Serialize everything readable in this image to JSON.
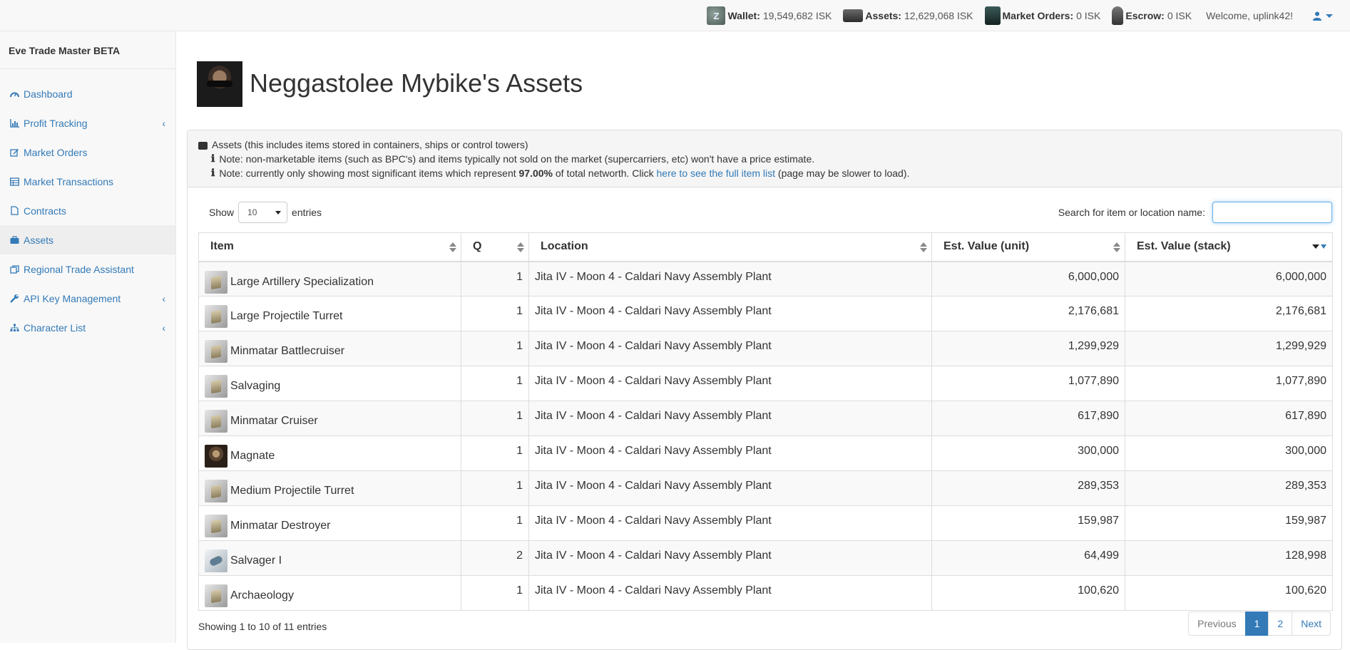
{
  "topbar": {
    "wallet_label": "Wallet:",
    "wallet_value": "19,549,682 ISK",
    "assets_label": "Assets:",
    "assets_value": "12,629,068 ISK",
    "orders_label": "Market Orders:",
    "orders_value": "0 ISK",
    "escrow_label": "Escrow:",
    "escrow_value": "0 ISK",
    "welcome": "Welcome, uplink42!"
  },
  "sidebar": {
    "brand": "Eve Trade Master BETA",
    "items": [
      {
        "label": "Dashboard",
        "icon": "dashboard-icon",
        "active": false,
        "has_submenu": false
      },
      {
        "label": "Profit Tracking",
        "icon": "bar-chart-icon",
        "active": false,
        "has_submenu": true
      },
      {
        "label": "Market Orders",
        "icon": "edit-icon",
        "active": false,
        "has_submenu": false
      },
      {
        "label": "Market Transactions",
        "icon": "table-icon",
        "active": false,
        "has_submenu": false
      },
      {
        "label": "Contracts",
        "icon": "file-icon",
        "active": false,
        "has_submenu": false
      },
      {
        "label": "Assets",
        "icon": "briefcase-icon",
        "active": true,
        "has_submenu": false
      },
      {
        "label": "Regional Trade Assistant",
        "icon": "clone-icon",
        "active": false,
        "has_submenu": false
      },
      {
        "label": "API Key Management",
        "icon": "wrench-icon",
        "active": false,
        "has_submenu": true
      },
      {
        "label": "Character List",
        "icon": "sitemap-icon",
        "active": false,
        "has_submenu": true
      }
    ]
  },
  "page": {
    "title": "Neggastolee Mybike's Assets"
  },
  "panel": {
    "heading": "Assets (this includes items stored in containers, ships or control towers)",
    "note1": "Note: non-marketable items (such as BPC's) and items typically not sold on the market (supercarriers, etc) won't have a price estimate.",
    "note2_pre": "Note: currently only showing most significant items which represent ",
    "note2_bold": "97.00%",
    "note2_mid": " of total networth. Click ",
    "note2_link": "here to see the full item list",
    "note2_post": " (page may be slower to load)."
  },
  "controls": {
    "show_label": "Show",
    "page_length": "10",
    "entries_label": "entries",
    "search_label": "Search for item or location name:",
    "search_value": ""
  },
  "table": {
    "headers": [
      "Item",
      "Q",
      "Location",
      "Est. Value (unit)",
      "Est. Value (stack)"
    ],
    "rows": [
      {
        "item": "Large Artillery Specialization",
        "icon": "skillbook-icon",
        "q": "1",
        "location": "Jita IV - Moon 4 - Caldari Navy Assembly Plant",
        "unit": "6,000,000",
        "stack": "6,000,000"
      },
      {
        "item": "Large Projectile Turret",
        "icon": "skillbook-icon",
        "q": "1",
        "location": "Jita IV - Moon 4 - Caldari Navy Assembly Plant",
        "unit": "2,176,681",
        "stack": "2,176,681"
      },
      {
        "item": "Minmatar Battlecruiser",
        "icon": "skillbook-icon",
        "q": "1",
        "location": "Jita IV - Moon 4 - Caldari Navy Assembly Plant",
        "unit": "1,299,929",
        "stack": "1,299,929"
      },
      {
        "item": "Salvaging",
        "icon": "skillbook-icon",
        "q": "1",
        "location": "Jita IV - Moon 4 - Caldari Navy Assembly Plant",
        "unit": "1,077,890",
        "stack": "1,077,890"
      },
      {
        "item": "Minmatar Cruiser",
        "icon": "skillbook-icon",
        "q": "1",
        "location": "Jita IV - Moon 4 - Caldari Navy Assembly Plant",
        "unit": "617,890",
        "stack": "617,890"
      },
      {
        "item": "Magnate",
        "icon": "ship-portrait-icon",
        "q": "1",
        "location": "Jita IV - Moon 4 - Caldari Navy Assembly Plant",
        "unit": "300,000",
        "stack": "300,000"
      },
      {
        "item": "Medium Projectile Turret",
        "icon": "skillbook-icon",
        "q": "1",
        "location": "Jita IV - Moon 4 - Caldari Navy Assembly Plant",
        "unit": "289,353",
        "stack": "289,353"
      },
      {
        "item": "Minmatar Destroyer",
        "icon": "skillbook-icon",
        "q": "1",
        "location": "Jita IV - Moon 4 - Caldari Navy Assembly Plant",
        "unit": "159,987",
        "stack": "159,987"
      },
      {
        "item": "Salvager I",
        "icon": "salvager-icon",
        "q": "2",
        "location": "Jita IV - Moon 4 - Caldari Navy Assembly Plant",
        "unit": "64,499",
        "stack": "128,998"
      },
      {
        "item": "Archaeology",
        "icon": "skillbook-icon",
        "q": "1",
        "location": "Jita IV - Moon 4 - Caldari Navy Assembly Plant",
        "unit": "100,620",
        "stack": "100,620"
      }
    ]
  },
  "footer": {
    "info": "Showing 1 to 10 of 11 entries",
    "prev": "Previous",
    "pages": [
      "1",
      "2"
    ],
    "next": "Next"
  },
  "colors": {
    "link": "#337ab7",
    "active_page": "#337ab7",
    "sidebar_bg": "#f8f8f8"
  }
}
